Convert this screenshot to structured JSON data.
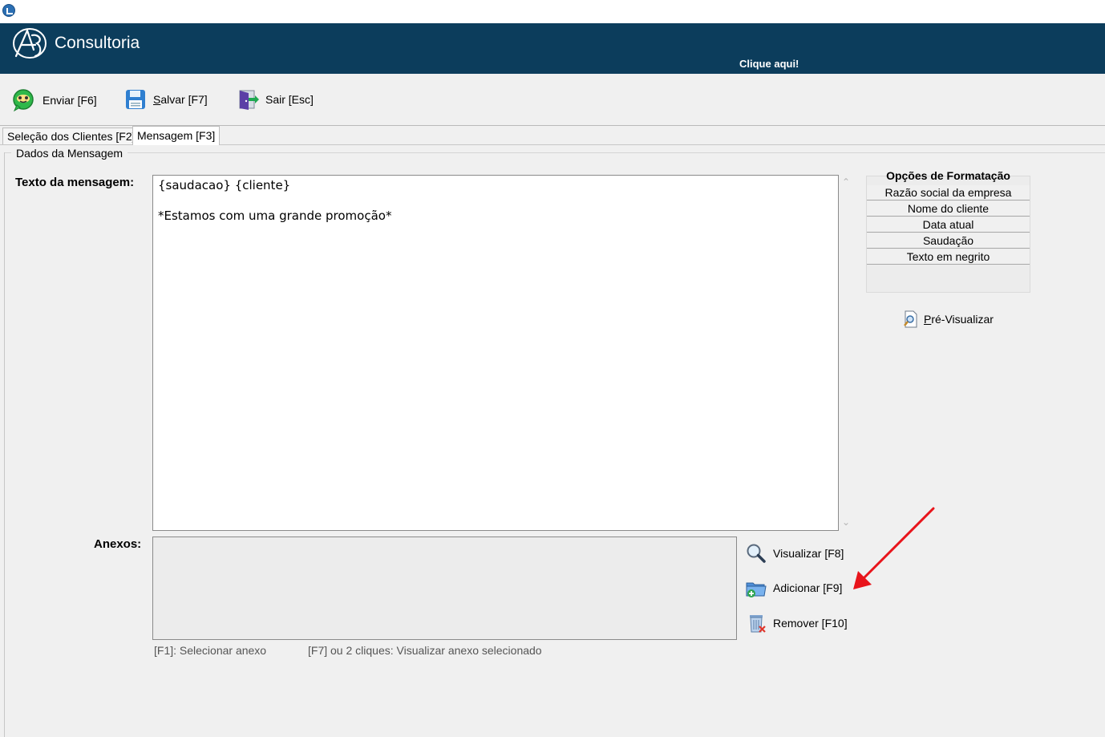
{
  "header": {
    "brand": "Consultoria",
    "link": "Clique aqui!"
  },
  "toolbar": {
    "send_label": "Enviar [F6]",
    "save_label": "alvar [F7]",
    "save_mnemonic": "S",
    "exit_label": "Sair [Esc]"
  },
  "tabs": [
    {
      "label": "Seleção dos Clientes [F2]"
    },
    {
      "label": "Mensagem [F3]"
    }
  ],
  "group": {
    "title": "Dados da Mensagem"
  },
  "message": {
    "label": "Texto da mensagem:",
    "lines": [
      "{saudacao} {cliente}",
      "",
      "*Estamos com uma grande promoção*"
    ]
  },
  "formatting": {
    "title": "Opções de Formatação",
    "options": [
      "Razão social da empresa",
      "Nome do cliente",
      "Data atual",
      "Saudação",
      "Texto em negrito"
    ],
    "preview_mnemonic": "P",
    "preview_label": "ré-Visualizar"
  },
  "attachments": {
    "label": "Anexos:",
    "view_label": "Visualizar  [F8]",
    "add_label": "Adicionar  [F9]",
    "remove_label": "Remover [F10]",
    "hint_select": "[F1]: Selecionar anexo",
    "hint_view": "[F7] ou 2 cliques: Visualizar anexo selecionado"
  },
  "colors": {
    "header_bg": "#0c3d5c",
    "arrow": "#e8141b"
  },
  "icons": [
    "app-icon",
    "whatsapp-icon",
    "floppy-disk-icon",
    "exit-door-icon",
    "magnifier-document-icon",
    "magnifier-icon",
    "folder-add-icon",
    "trash-icon",
    "red-arrow-annotation"
  ]
}
